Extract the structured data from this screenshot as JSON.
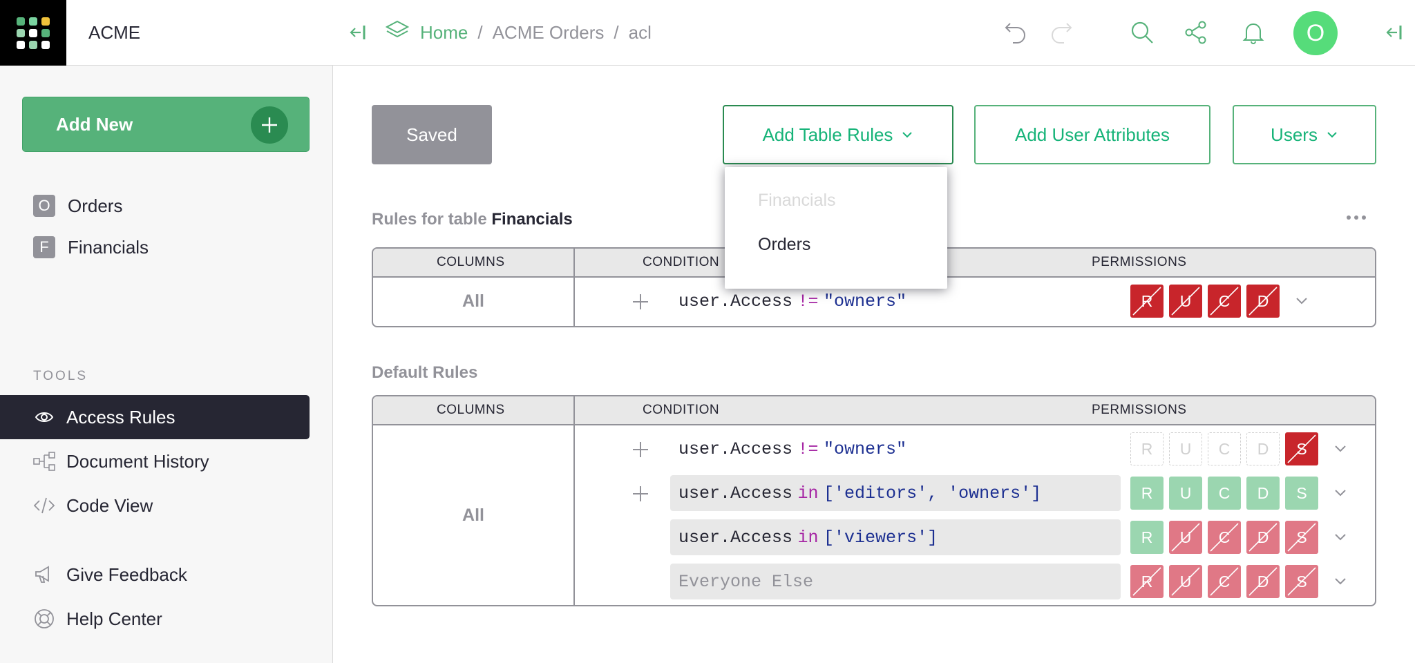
{
  "org": {
    "name": "ACME"
  },
  "sidebar": {
    "add_new_label": "Add New",
    "pages": [
      {
        "badge": "O",
        "label": "Orders"
      },
      {
        "badge": "F",
        "label": "Financials"
      }
    ],
    "tools_label": "TOOLS",
    "tools": [
      {
        "label": "Access Rules",
        "icon": "eye-icon",
        "active": true
      },
      {
        "label": "Document History",
        "icon": "history-icon"
      },
      {
        "label": "Code View",
        "icon": "code-icon"
      }
    ],
    "footer": [
      {
        "label": "Give Feedback",
        "icon": "megaphone-icon"
      },
      {
        "label": "Help Center",
        "icon": "lifebuoy-icon"
      }
    ]
  },
  "breadcrumb": {
    "home": "Home",
    "sep1": "/",
    "doc": "ACME Orders",
    "sep2": "/",
    "page": "acl"
  },
  "user": {
    "avatar_initial": "O"
  },
  "toolbar": {
    "saved_label": "Saved",
    "add_table_rules_label": "Add Table Rules",
    "add_user_attributes_label": "Add User Attributes",
    "users_label": "Users"
  },
  "dropdown": {
    "items": [
      {
        "label": "Financials",
        "disabled": true
      },
      {
        "label": "Orders",
        "disabled": false
      }
    ]
  },
  "table_rules": {
    "title_prefix": "Rules for table ",
    "table_name": "Financials",
    "headers": {
      "columns": "COLUMNS",
      "condition": "CONDITION",
      "permissions": "PERMISSIONS"
    },
    "columns_value": "All",
    "rules": [
      {
        "lhs": "user.Access",
        "op": "!=",
        "rhs": "\"owners\"",
        "perms": [
          "R",
          "U",
          "C",
          "D"
        ],
        "states": [
          "deny",
          "deny",
          "deny",
          "deny"
        ]
      }
    ]
  },
  "default_rules": {
    "title": "Default Rules",
    "headers": {
      "columns": "COLUMNS",
      "condition": "CONDITION",
      "permissions": "PERMISSIONS"
    },
    "columns_value": "All",
    "rules": [
      {
        "lhs": "user.Access",
        "op": "!=",
        "rhs": "\"owners\"",
        "perms": [
          "R",
          "U",
          "C",
          "D",
          "S"
        ],
        "states": [
          "unset",
          "unset",
          "unset",
          "unset",
          "deny"
        ]
      },
      {
        "lhs": "user.Access",
        "op": "in",
        "rhs": "['editors', 'owners']",
        "perms": [
          "R",
          "U",
          "C",
          "D",
          "S"
        ],
        "states": [
          "allow-l",
          "allow-l",
          "allow-l",
          "allow-l",
          "allow-l"
        ]
      },
      {
        "lhs": "user.Access",
        "op": "in",
        "rhs": "['viewers']",
        "perms": [
          "R",
          "U",
          "C",
          "D",
          "S"
        ],
        "states": [
          "allow-l",
          "deny-l",
          "deny-l",
          "deny-l",
          "deny-l"
        ]
      },
      {
        "placeholder": "Everyone Else",
        "perms": [
          "R",
          "U",
          "C",
          "D",
          "S"
        ],
        "states": [
          "deny-l",
          "deny-l",
          "deny-l",
          "deny-l",
          "deny-l"
        ]
      }
    ]
  },
  "colors": {
    "accent": "#56b27a",
    "accent_dark": "#2a8b51",
    "deny": "#c8252b",
    "deny_light": "#e07886",
    "allow_light": "#9bd6b0",
    "text": "#262633",
    "muted": "#929299"
  }
}
